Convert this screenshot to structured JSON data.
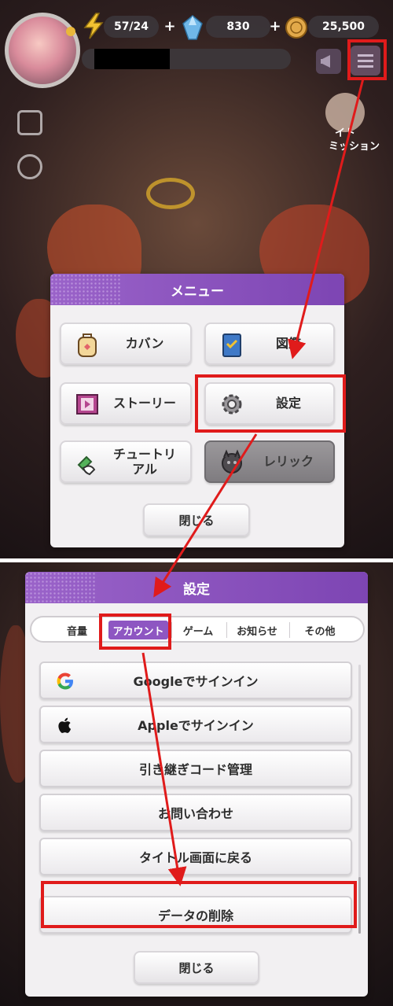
{
  "hud": {
    "stamina": "57/24",
    "gems": "830",
    "coins": "25,500",
    "plus": "+",
    "right_badge_label": "ミッション",
    "right_badge_label_top": "イト"
  },
  "menu": {
    "title": "メニュー",
    "items": [
      {
        "label": "カバン"
      },
      {
        "label": "図鑑"
      },
      {
        "label": "ストーリー"
      },
      {
        "label": "設定"
      },
      {
        "label": "チュートリ\nアル"
      },
      {
        "label": "レリック"
      }
    ],
    "close_label": "閉じる"
  },
  "settings": {
    "title": "設定",
    "tabs": [
      "音量",
      "アカウント",
      "ゲーム",
      "お知らせ",
      "その他"
    ],
    "rows": [
      {
        "label": "Googleでサインイン"
      },
      {
        "label": "Appleでサインイン"
      },
      {
        "label": "引き継ぎコード管理"
      },
      {
        "label": "お問い合わせ"
      },
      {
        "label": "タイトル画面に戻る"
      },
      {
        "label": "データの削除"
      }
    ],
    "close_label": "閉じる"
  },
  "colors": {
    "accent": "#8e56c2",
    "highlight": "#e01b1b"
  }
}
